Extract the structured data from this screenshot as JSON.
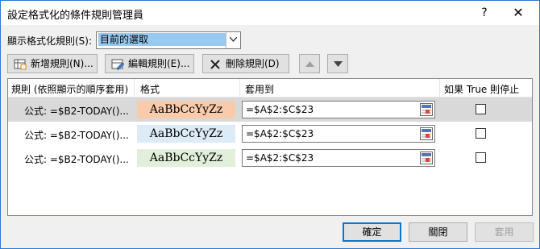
{
  "window": {
    "title": "設定格式化的條件規則管理員",
    "help_glyph": "?",
    "close_glyph": "✕"
  },
  "show_rules": {
    "label": "顯示格式化規則(S):",
    "selected": "目前的選取"
  },
  "toolbar": {
    "new_rule": "新增規則(N)...",
    "edit_rule": "編輯規則(E)...",
    "delete_rule": "刪除規則(D)"
  },
  "table": {
    "headers": [
      "規則 (依照顯示的順序套用)",
      "格式",
      "套用到",
      "如果 True 則停止"
    ],
    "rows": [
      {
        "rule": "公式: =$B2-TODAY()...",
        "preview": "AaBbCcYyZz",
        "applies_to": "=$A$2:$C$23",
        "stop_if_true": false,
        "format_bg": "#f8cbad",
        "selected": true
      },
      {
        "rule": "公式: =$B2-TODAY()...",
        "preview": "AaBbCcYyZz",
        "applies_to": "=$A$2:$C$23",
        "stop_if_true": false,
        "format_bg": "#ddebf7",
        "selected": false
      },
      {
        "rule": "公式: =$B2-TODAY()...",
        "preview": "AaBbCcYyZz",
        "applies_to": "=$A$2:$C$23",
        "stop_if_true": false,
        "format_bg": "#e2efda",
        "selected": false
      }
    ]
  },
  "buttons": {
    "ok": "確定",
    "close": "關閉",
    "apply": "套用"
  }
}
